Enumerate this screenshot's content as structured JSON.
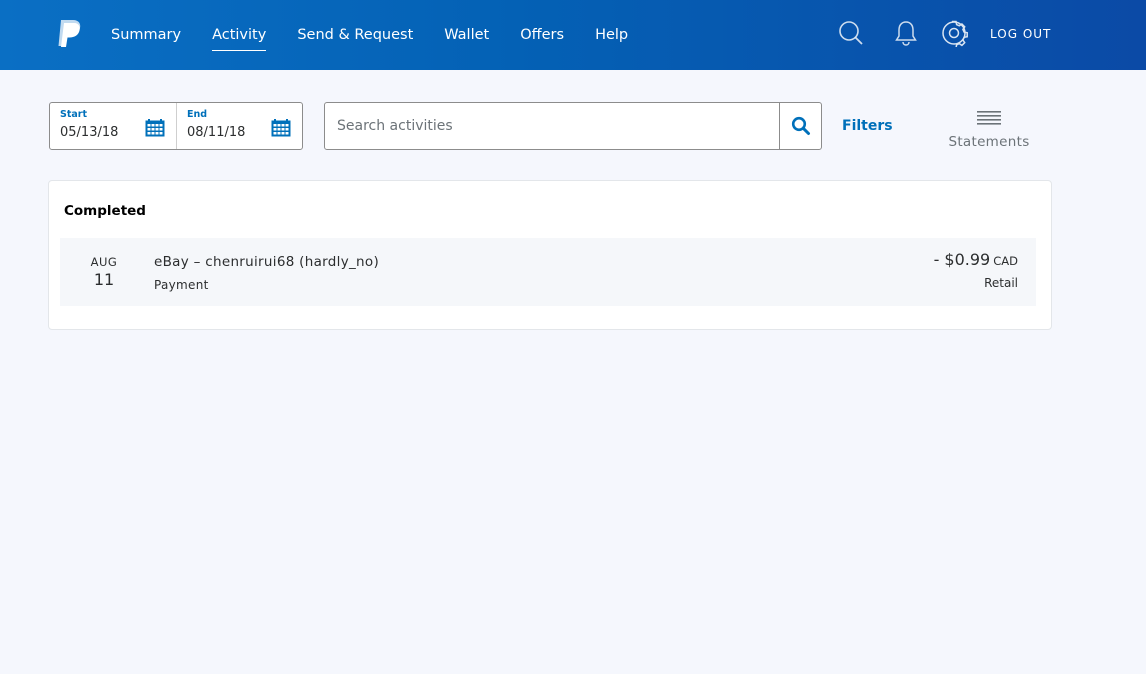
{
  "nav": {
    "items": [
      {
        "label": "Summary",
        "active": false
      },
      {
        "label": "Activity",
        "active": true
      },
      {
        "label": "Send & Request",
        "active": false
      },
      {
        "label": "Wallet",
        "active": false
      },
      {
        "label": "Offers",
        "active": false
      },
      {
        "label": "Help",
        "active": false
      }
    ],
    "logout_label": "LOG OUT",
    "icons": [
      "search-icon",
      "bell-icon",
      "gear-icon"
    ]
  },
  "date_range": {
    "start_label": "Start",
    "start_value": "05/13/18",
    "end_label": "End",
    "end_value": "08/11/18"
  },
  "search": {
    "placeholder": "Search activities",
    "value": ""
  },
  "toolbar": {
    "filters_label": "Filters",
    "statements_label": "Statements"
  },
  "activity": {
    "section_title": "Completed",
    "rows": [
      {
        "month": "AUG",
        "day": "11",
        "name": "eBay – chenruirui68 (hardly_no)",
        "type": "Payment",
        "amount": "- $0.99",
        "currency": "CAD",
        "category": "Retail"
      }
    ]
  },
  "colors": {
    "brand_blue": "#0070ba",
    "header_gradient_start": "#0a6fc4",
    "header_gradient_end": "#0b4aa6",
    "page_background": "#f5f7fd"
  }
}
